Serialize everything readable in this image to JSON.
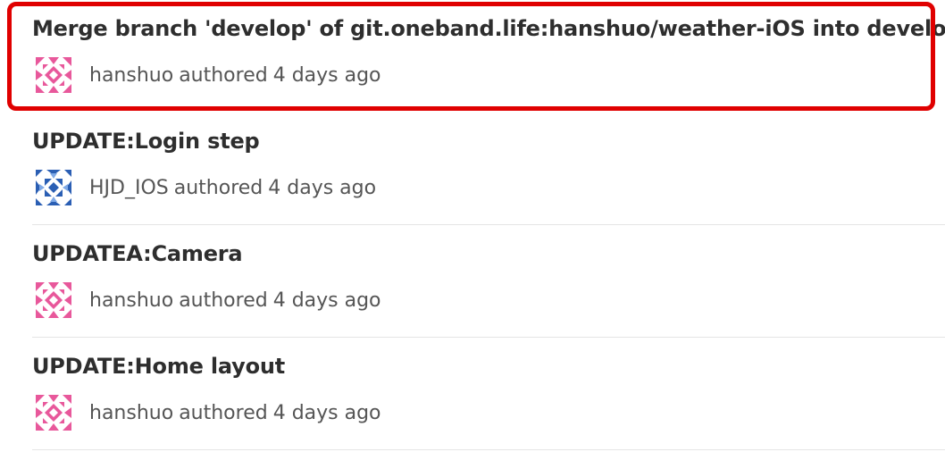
{
  "commits": [
    {
      "title": "Merge branch 'develop' of git.oneband.life:hanshuo/weather-iOS into develop",
      "author": "hanshuo",
      "verb": "authored",
      "time": "4 days ago",
      "avatar_icon": "identicon-pink",
      "avatar_color": "#e8589b"
    },
    {
      "title": "UPDATE:Login step",
      "author": "HJD_IOS",
      "verb": "authored",
      "time": "4 days ago",
      "avatar_icon": "identicon-blue",
      "avatar_color": "#2b5fb4"
    },
    {
      "title": "UPDATEA:Camera",
      "author": "hanshuo",
      "verb": "authored",
      "time": "4 days ago",
      "avatar_icon": "identicon-pink",
      "avatar_color": "#e8589b"
    },
    {
      "title": "UPDATE:Home layout",
      "author": "hanshuo",
      "verb": "authored",
      "time": "4 days ago",
      "avatar_icon": "identicon-pink",
      "avatar_color": "#e8589b"
    }
  ],
  "highlight_color": "#e00000"
}
